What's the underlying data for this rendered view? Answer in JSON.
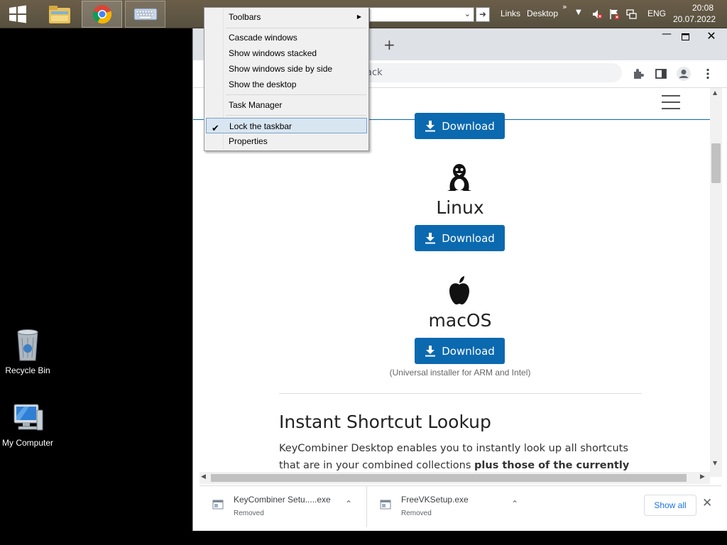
{
  "taskbar": {
    "links_label": "Links",
    "desktop_label": "Desktop",
    "more_label": "»",
    "lang": "ENG",
    "time": "20:08",
    "date": "20.07.2022"
  },
  "desktop": {
    "icons": [
      {
        "label": "Recycle Bin"
      },
      {
        "label": "My Computer"
      }
    ]
  },
  "browser": {
    "omnibox_text": "ack",
    "new_tab_label": "+",
    "page": {
      "download_label": "Download",
      "linux_name": "Linux",
      "mac_name": "macOS",
      "mac_note": "(Universal installer for ARM and Intel)",
      "section_title": "Instant Shortcut Lookup",
      "section_body_1": "KeyCombiner Desktop enables you to instantly look up all shortcuts that are in your combined collections ",
      "section_body_bold": "plus those of the currently active"
    },
    "downloads": [
      {
        "name": "KeyCombiner Setu.....exe",
        "status": "Removed"
      },
      {
        "name": "FreeVKSetup.exe",
        "status": "Removed"
      }
    ],
    "show_all": "Show all"
  },
  "context_menu": {
    "items": [
      {
        "label": "Toolbars",
        "submenu": true
      },
      {
        "label": "Cascade windows"
      },
      {
        "label": "Show windows stacked"
      },
      {
        "label": "Show windows side by side"
      },
      {
        "label": "Show the desktop"
      },
      {
        "label": "Task Manager"
      },
      {
        "label": "Lock the taskbar",
        "checked": true
      },
      {
        "label": "Properties"
      }
    ]
  },
  "colors": {
    "accent_blue": "#0b69af",
    "taskbar": "#6b5e49",
    "menu_highlight": "#d8e6f2"
  }
}
